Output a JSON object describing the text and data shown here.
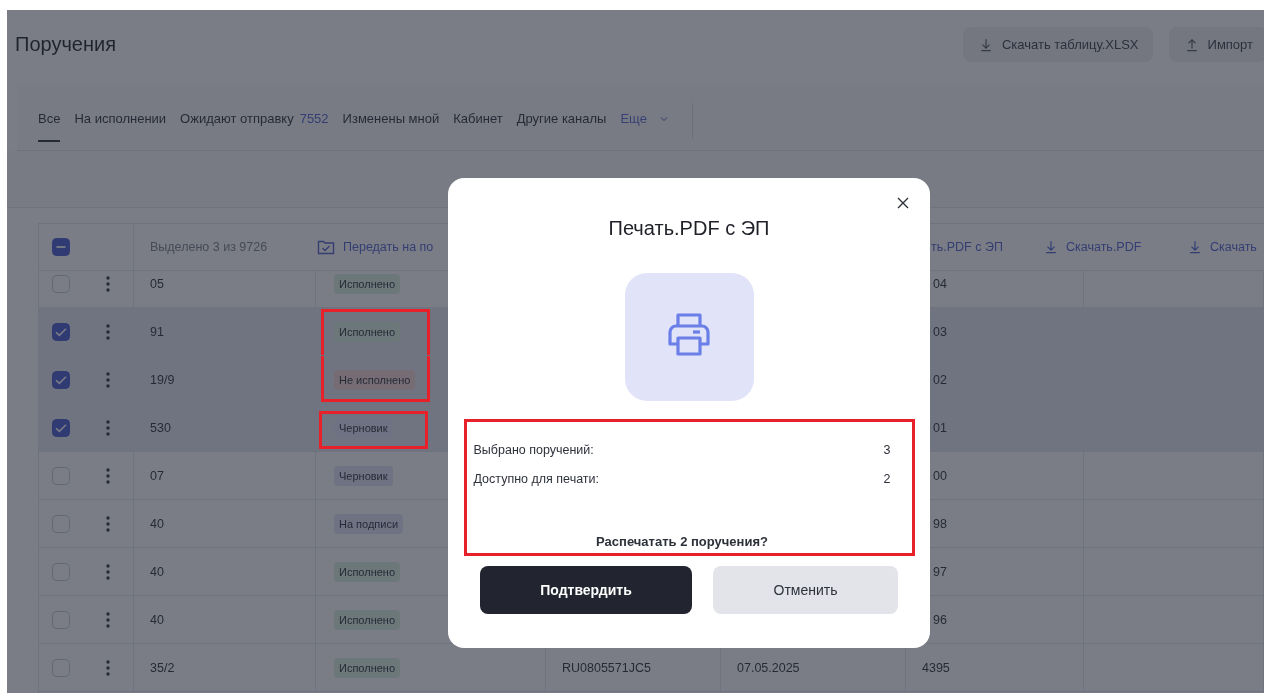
{
  "page": {
    "title": "Поручения"
  },
  "toolbar": [
    {
      "label": "Скачать таблицу.XLSX",
      "kind": "download"
    },
    {
      "label": "Импорт",
      "kind": "upload"
    }
  ],
  "tabs": [
    {
      "label": "Все",
      "selected": true,
      "kind": "plain"
    },
    {
      "label": "На исполнении",
      "selected": false,
      "kind": "plain"
    },
    {
      "label": "Ожидают отправку",
      "count": "7552",
      "selected": false,
      "kind": "plain"
    },
    {
      "label": "Изменены мной",
      "selected": false,
      "kind": "plain"
    },
    {
      "label": "Кабинет",
      "selected": false,
      "kind": "plain"
    },
    {
      "label": "Другие каналы",
      "selected": false,
      "kind": "plain"
    },
    {
      "label": "Еще",
      "selected": false,
      "kind": "more"
    }
  ],
  "table": {
    "select_all_checked": true,
    "select_all_partial": true,
    "selection_text": "Выделено 3 из 9726",
    "actions": [
      {
        "label": "Передать на по",
        "kind": "folder"
      },
      {
        "label": "ть.PDF с ЭП",
        "kind": "text"
      },
      {
        "label": "Скачать.PDF",
        "kind": "download"
      },
      {
        "label": "Скачать",
        "kind": "download"
      }
    ],
    "rows": [
      {
        "checked": false,
        "number": "05",
        "status": {
          "label": "Исполнено",
          "kind": "done"
        },
        "frame_top": false,
        "frame_bottom": false,
        "id": "04"
      },
      {
        "checked": true,
        "number": "91",
        "status": {
          "label": "Исполнено",
          "kind": "done"
        },
        "frame_top": true,
        "frame_bottom": false,
        "id": "03"
      },
      {
        "checked": true,
        "number": "19/9",
        "status": {
          "label": "Не исполнено",
          "kind": "failed"
        },
        "frame_top": false,
        "frame_bottom": true,
        "id": "02"
      },
      {
        "checked": true,
        "number": "530",
        "status": {
          "label": "Черновик",
          "kind": "draft"
        },
        "frame_top": true,
        "frame_bottom": true,
        "id": "01"
      },
      {
        "checked": false,
        "number": "07",
        "status": {
          "label": "Черновик",
          "kind": "draft"
        },
        "frame_top": false,
        "frame_bottom": false,
        "id": "00"
      },
      {
        "checked": false,
        "number": "40",
        "status": {
          "label": "На подписи",
          "kind": "signing"
        },
        "frame_top": false,
        "frame_bottom": false,
        "id": "98"
      },
      {
        "checked": false,
        "number": "40",
        "status": {
          "label": "Исполнено",
          "kind": "done"
        },
        "frame_top": false,
        "frame_bottom": false,
        "id": "97"
      },
      {
        "checked": false,
        "number": "40",
        "status": {
          "label": "Исполнено",
          "kind": "done"
        },
        "frame_top": false,
        "frame_bottom": false,
        "id": "96"
      },
      {
        "checked": false,
        "number": "35/2",
        "status": {
          "label": "Исполнено",
          "kind": "done"
        },
        "frame_top": false,
        "frame_bottom": false,
        "code": "RU0805571JC5",
        "date": "07.05.2025",
        "id": "4395"
      }
    ]
  },
  "dialog": {
    "title": "Печать.PDF с ЭП",
    "highlighted": true,
    "summary": [
      {
        "label": "Выбрано поручений:",
        "value": "3"
      },
      {
        "label": "Доступно для печати:",
        "value": "2"
      }
    ],
    "question": "Распечатать 2 поручения?",
    "buttons": [
      {
        "label": "Подтвердить",
        "kind": "primary"
      },
      {
        "label": "Отменить",
        "kind": "secondary"
      }
    ]
  }
}
